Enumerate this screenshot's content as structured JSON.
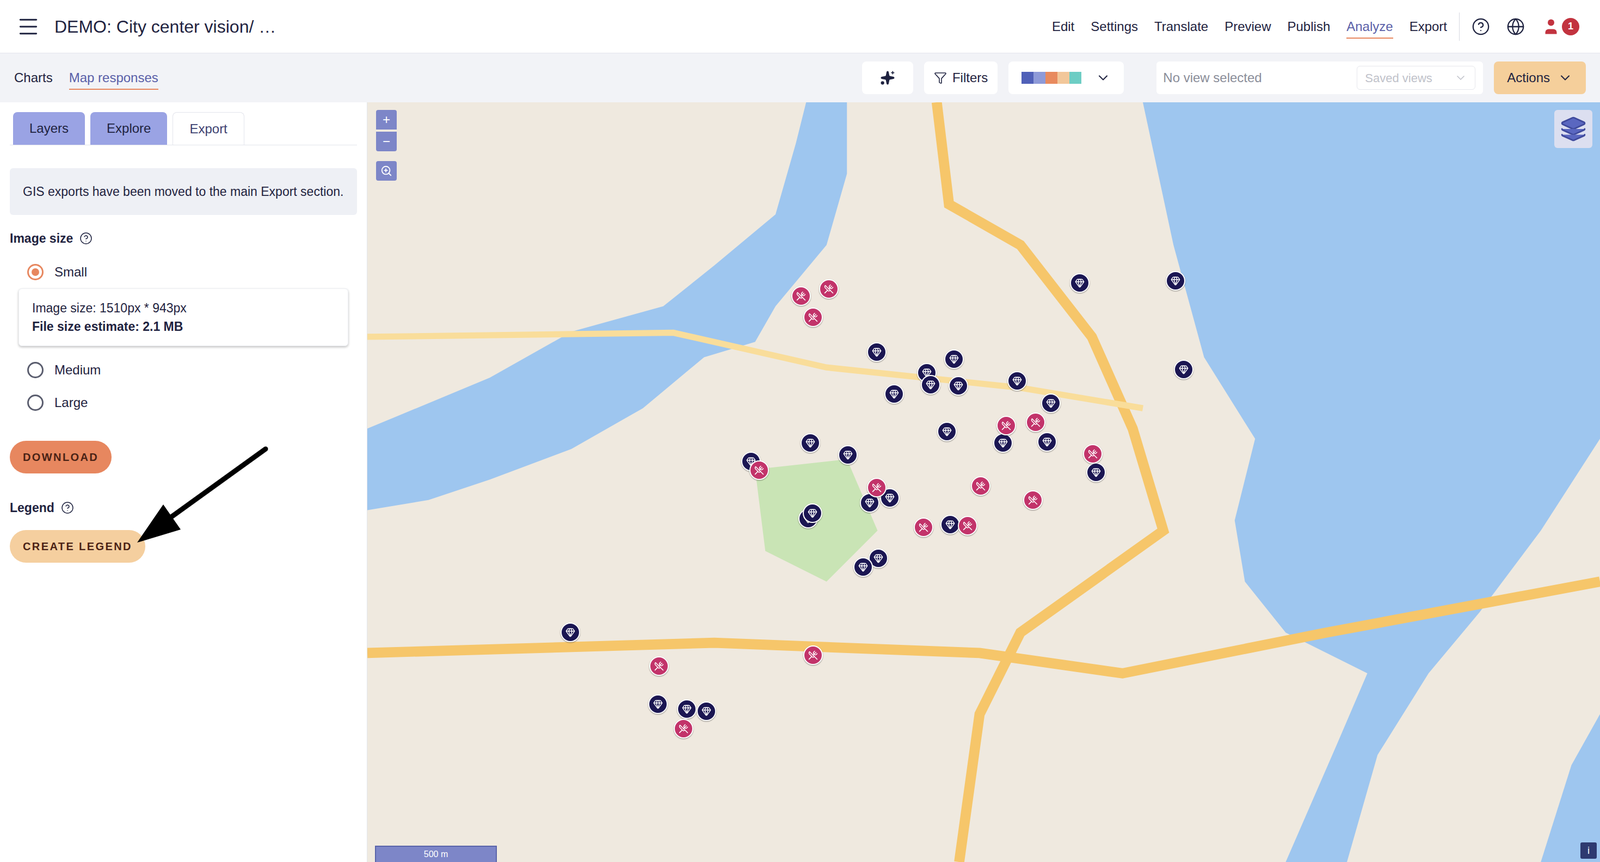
{
  "header": {
    "title": "DEMO: City center vision/ …",
    "nav": [
      {
        "label": "Edit",
        "selected": false
      },
      {
        "label": "Settings",
        "selected": false
      },
      {
        "label": "Translate",
        "selected": false
      },
      {
        "label": "Preview",
        "selected": false
      },
      {
        "label": "Publish",
        "selected": false
      },
      {
        "label": "Analyze",
        "selected": true
      },
      {
        "label": "Export",
        "selected": false
      }
    ],
    "notifications": "1"
  },
  "subnav": {
    "tabs": [
      {
        "label": "Charts",
        "selected": false
      },
      {
        "label": "Map responses",
        "selected": true
      }
    ],
    "filters": "Filters",
    "palette": [
      "#5060b8",
      "#8e9ad8",
      "#e88a5e",
      "#f2c79a",
      "#6dcdc4"
    ],
    "view": {
      "placeholder": "No view selected",
      "saved": "Saved views"
    },
    "actions": "Actions"
  },
  "panel": {
    "tabs": [
      {
        "label": "Layers",
        "selected": false
      },
      {
        "label": "Explore",
        "selected": false
      },
      {
        "label": "Export",
        "selected": true
      }
    ],
    "notice": "GIS exports have been moved to the main Export section.",
    "image_size": {
      "label": "Image size",
      "options": [
        {
          "label": "Small",
          "selected": true
        },
        {
          "label": "Medium",
          "selected": false
        },
        {
          "label": "Large",
          "selected": false
        }
      ],
      "details": {
        "size": "Image size: 1510px * 943px",
        "estimate": "File size estimate: 2.1 MB"
      }
    },
    "download": "DOWNLOAD",
    "legend": {
      "label": "Legend",
      "button": "CREATE LEGEND"
    }
  },
  "map": {
    "zoom_in": "+",
    "zoom_out": "−",
    "scale": "500 m",
    "info": "i",
    "pins": [
      {
        "kind": "diamond",
        "color": "#1b1652"
      },
      {
        "kind": "diamond",
        "color": "#1b1652"
      },
      {
        "kind": "diamond",
        "color": "#1b1652"
      },
      {
        "kind": "diamond",
        "color": "#1b1652"
      },
      {
        "kind": "diamond",
        "color": "#1b1652"
      },
      {
        "kind": "diamond",
        "color": "#1b1652"
      },
      {
        "kind": "diamond",
        "color": "#1b1652"
      },
      {
        "kind": "diamond",
        "color": "#1b1652"
      },
      {
        "kind": "diamond",
        "color": "#1b1652"
      },
      {
        "kind": "diamond",
        "color": "#1b1652"
      },
      {
        "kind": "diamond",
        "color": "#1b1652"
      },
      {
        "kind": "diamond",
        "color": "#1b1652"
      },
      {
        "kind": "diamond",
        "color": "#1b1652"
      },
      {
        "kind": "diamond",
        "color": "#1b1652"
      },
      {
        "kind": "diamond",
        "color": "#1b1652"
      },
      {
        "kind": "diamond",
        "color": "#1b1652"
      },
      {
        "kind": "diamond",
        "color": "#1b1652"
      },
      {
        "kind": "diamond",
        "color": "#1b1652"
      },
      {
        "kind": "diamond",
        "color": "#1b1652"
      },
      {
        "kind": "diamond",
        "color": "#1b1652"
      },
      {
        "kind": "diamond",
        "color": "#1b1652"
      },
      {
        "kind": "diamond",
        "color": "#1b1652"
      },
      {
        "kind": "diamond",
        "color": "#1b1652"
      },
      {
        "kind": "diamond",
        "color": "#1b1652"
      },
      {
        "kind": "diamond",
        "color": "#1b1652"
      },
      {
        "kind": "diamond",
        "color": "#1b1652"
      },
      {
        "kind": "diamond",
        "color": "#1b1652"
      },
      {
        "kind": "diamond",
        "color": "#1b1652"
      },
      {
        "kind": "diamond",
        "color": "#1b1652"
      },
      {
        "kind": "cross",
        "color": "#c2336a"
      },
      {
        "kind": "cross",
        "color": "#c2336a"
      },
      {
        "kind": "cross",
        "color": "#c2336a"
      },
      {
        "kind": "cross",
        "color": "#c2336a"
      },
      {
        "kind": "cross",
        "color": "#c2336a"
      },
      {
        "kind": "cross",
        "color": "#c2336a"
      },
      {
        "kind": "cross",
        "color": "#c2336a"
      },
      {
        "kind": "cross",
        "color": "#c2336a"
      },
      {
        "kind": "cross",
        "color": "#c2336a"
      },
      {
        "kind": "cross",
        "color": "#c2336a"
      },
      {
        "kind": "cross",
        "color": "#c2336a"
      },
      {
        "kind": "cross",
        "color": "#c2336a"
      },
      {
        "kind": "cross",
        "color": "#c2336a"
      },
      {
        "kind": "cross",
        "color": "#c2336a"
      },
      {
        "kind": "cross",
        "color": "#c2336a"
      }
    ]
  }
}
